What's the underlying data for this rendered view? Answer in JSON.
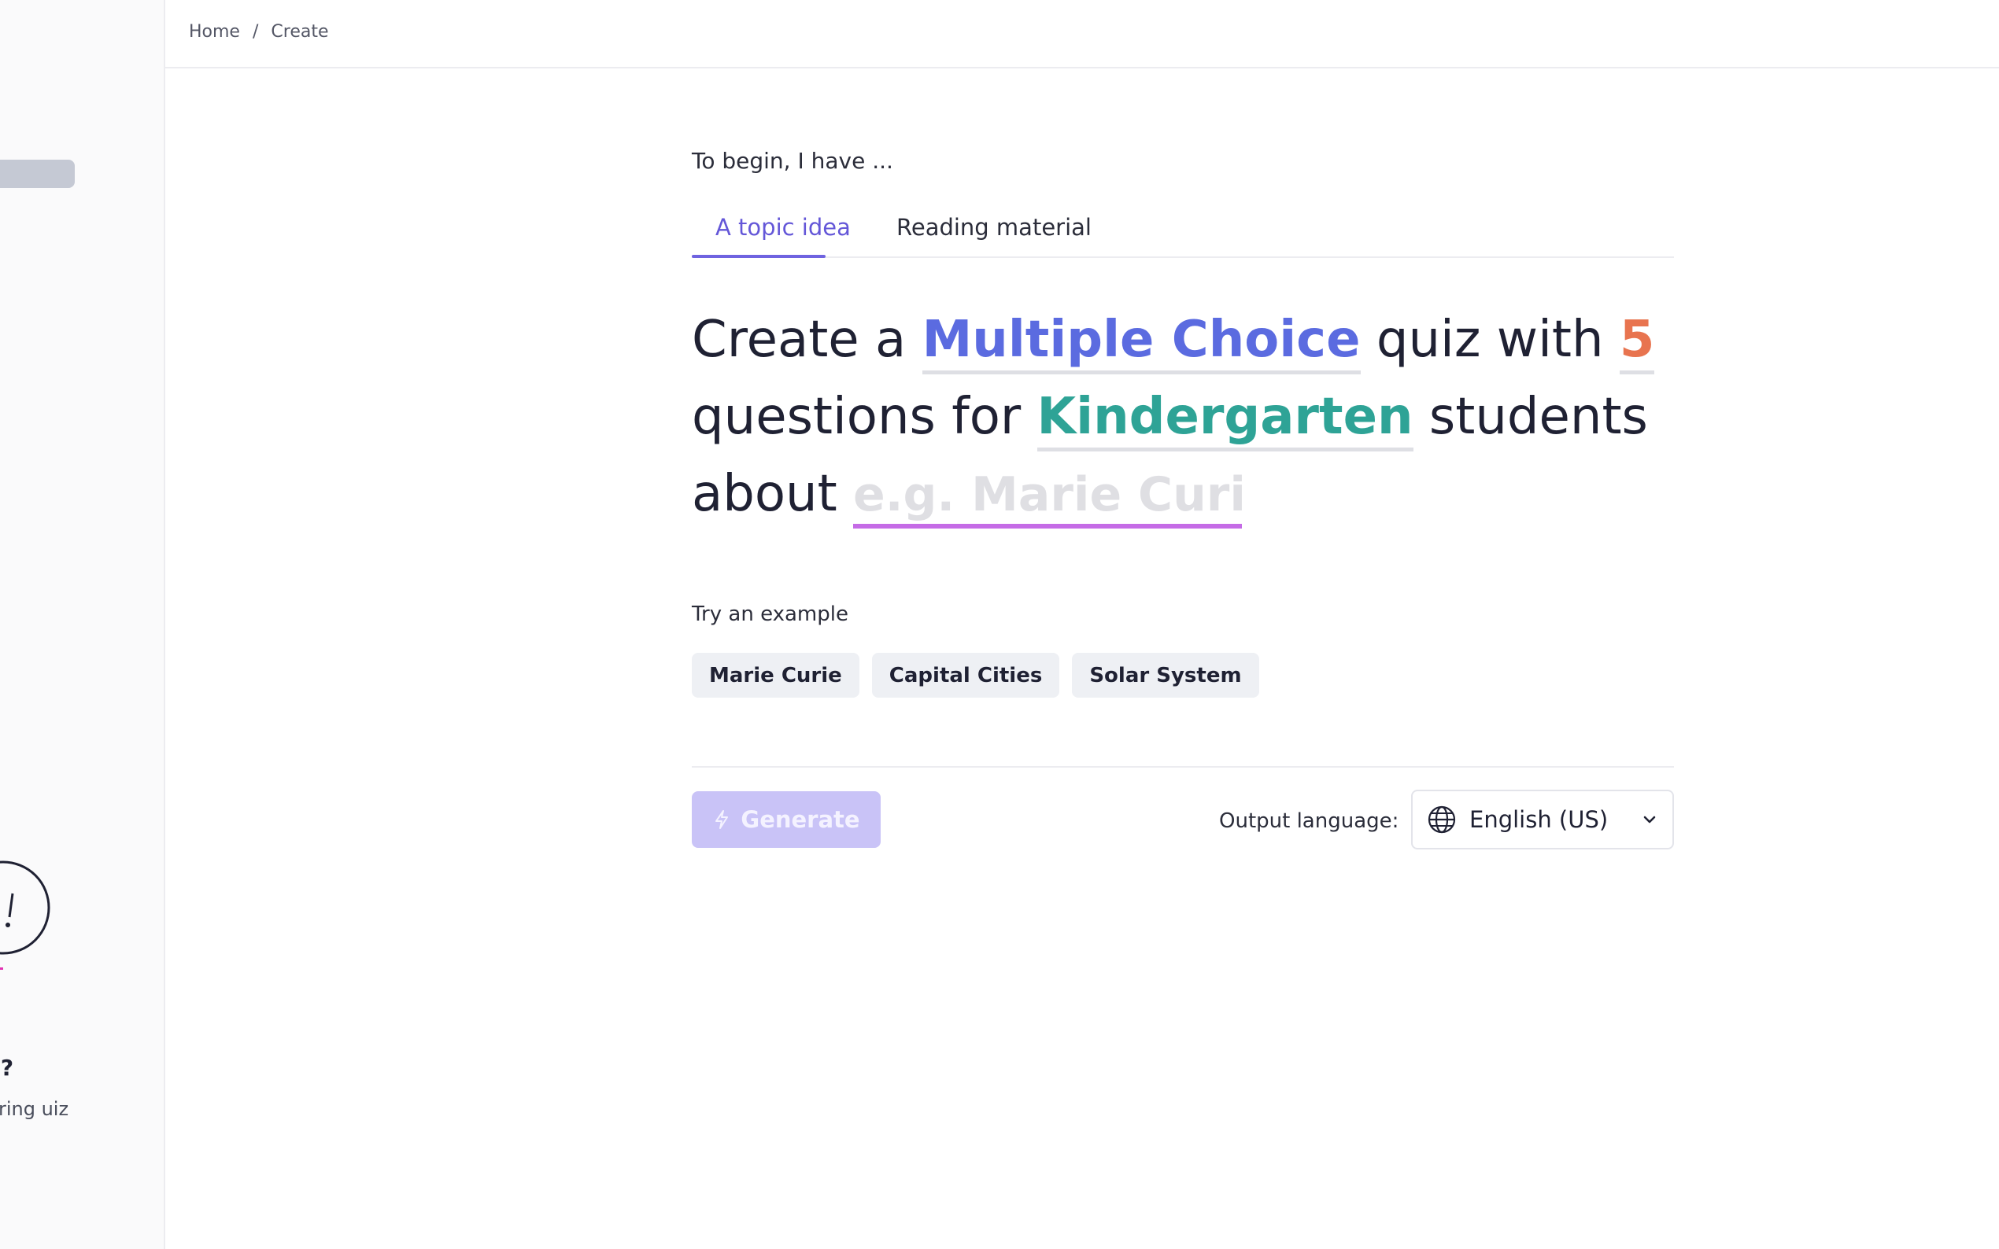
{
  "breadcrumb": {
    "home": "Home",
    "separator": "/",
    "current": "Create"
  },
  "sidebar": {
    "heading": "code?",
    "description": "y entering uiz code",
    "link": "quiz"
  },
  "intro": "To begin, I have ...",
  "tabs": [
    {
      "label": "A topic idea",
      "active": true
    },
    {
      "label": "Reading material",
      "active": false
    }
  ],
  "sentence": {
    "part1": "Create a",
    "quiz_type": "Multiple Choice",
    "part2": "quiz with",
    "question_count": "5",
    "part3": "questions for",
    "grade_level": "Kindergarten",
    "part4": "students",
    "part5": "about",
    "topic_value": "",
    "topic_placeholder": "e.g. Marie Curie"
  },
  "examples": {
    "label": "Try an example",
    "items": [
      "Marie Curie",
      "Capital Cities",
      "Solar System"
    ]
  },
  "generate": {
    "label": "Generate",
    "icon": "lightning-icon"
  },
  "output_language": {
    "label": "Output language:",
    "value": "English (US)",
    "icon": "globe-icon"
  },
  "colors": {
    "accent": "#6457d8",
    "quiz_type": "#5b6be0",
    "question_count": "#e8744f",
    "grade_level": "#2ea396",
    "topic_underline": "#c56be6",
    "link": "#e233b3",
    "generate_disabled_bg": "#c9c3f7"
  }
}
